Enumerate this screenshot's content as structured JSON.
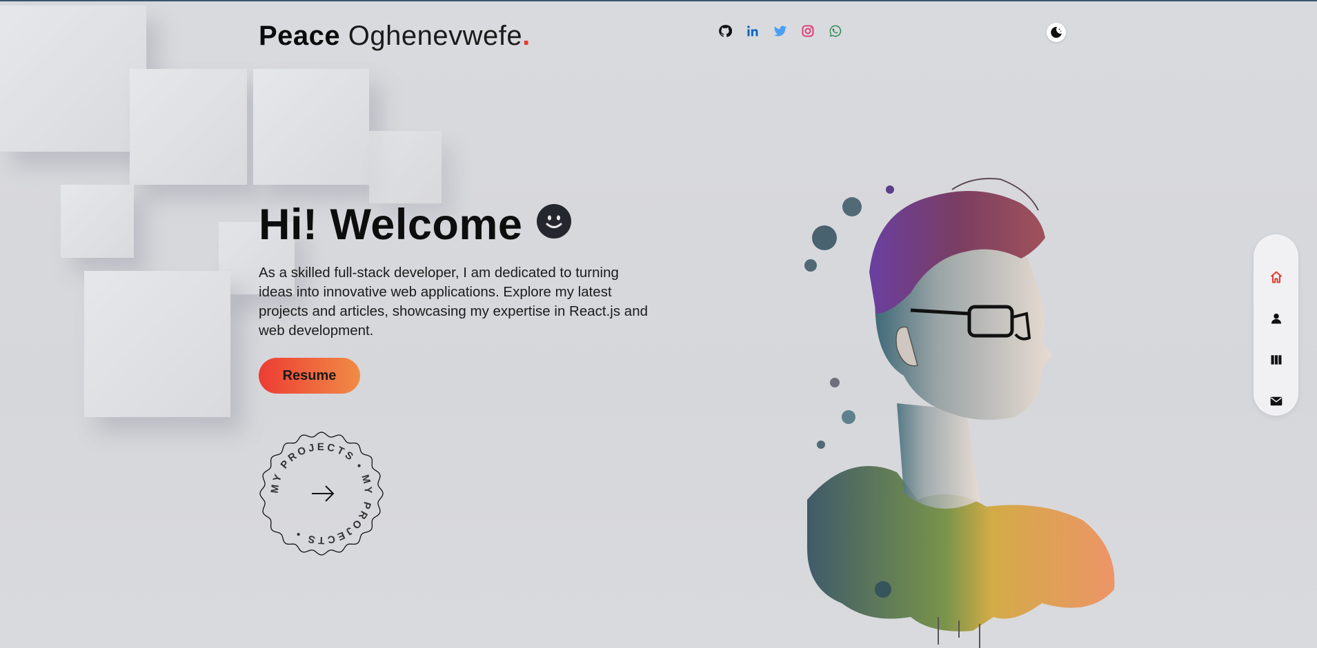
{
  "header": {
    "first_name": "Peace",
    "last_name": "Oghenevwefe",
    "dot": ".",
    "socials": [
      {
        "name": "github-icon",
        "color": "#111111"
      },
      {
        "name": "linkedin-icon",
        "color": "#0a66c2"
      },
      {
        "name": "twitter-icon",
        "color": "#4a9ff5"
      },
      {
        "name": "instagram-icon",
        "color": "#e1306c"
      },
      {
        "name": "whatsapp-icon",
        "color": "#2e8b57"
      }
    ],
    "theme_toggle_icon": "moon-icon"
  },
  "hero": {
    "title": "Hi! Welcome",
    "emoji_icon": "smiley-icon",
    "description": "As a skilled full-stack developer, I am dedicated to turning ideas into innovative web applications. Explore my latest projects and articles, showcasing my expertise in React.js and web development.",
    "resume_label": "Resume",
    "projects_badge_text": "MY PROJECTS • MY PROJECTS •"
  },
  "sidenav": {
    "items": [
      {
        "name": "home-icon",
        "active": true
      },
      {
        "name": "user-icon",
        "active": false
      },
      {
        "name": "projects-icon",
        "active": false
      },
      {
        "name": "mail-icon",
        "active": false
      }
    ]
  },
  "colors": {
    "accent": "#e53b2c",
    "resume_gradient_start": "#ed3c34",
    "resume_gradient_end": "#f08c45"
  }
}
